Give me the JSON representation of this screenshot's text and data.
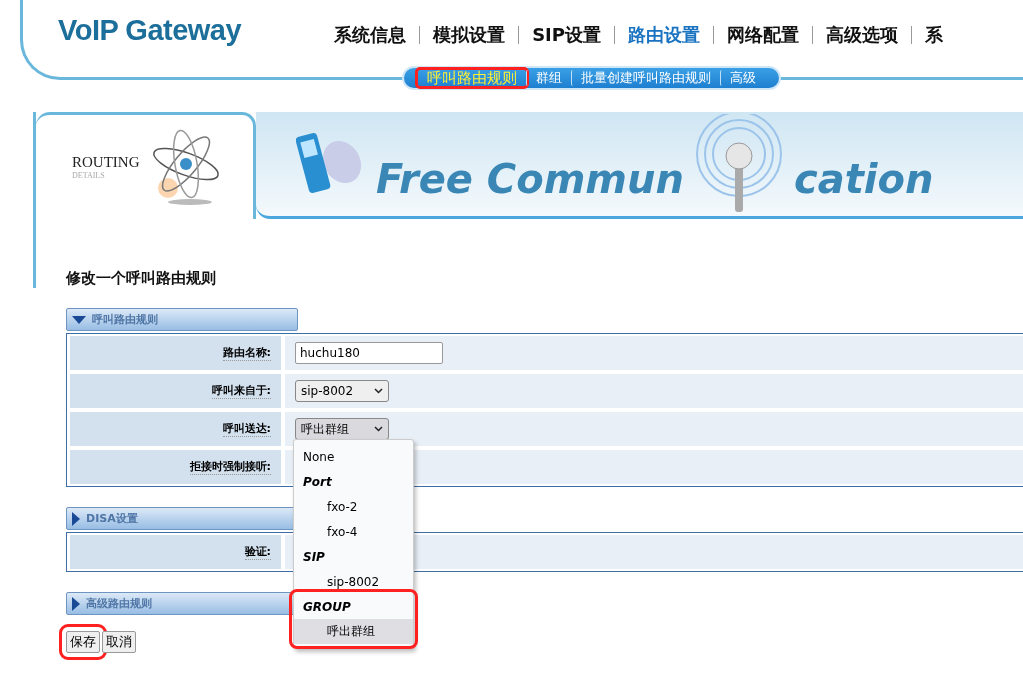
{
  "header": {
    "logo": "VoIP Gateway",
    "nav": [
      {
        "label": "系统信息",
        "selected": false
      },
      {
        "label": "模拟设置",
        "selected": false
      },
      {
        "label": "SIP设置",
        "selected": false
      },
      {
        "label": "路由设置",
        "selected": true
      },
      {
        "label": "网络配置",
        "selected": false
      },
      {
        "label": "高级选项",
        "selected": false
      },
      {
        "label": "系",
        "selected": false
      }
    ]
  },
  "subnav": [
    {
      "label": "呼叫路由规则",
      "selected": true,
      "highlighted": true
    },
    {
      "label": "群组",
      "selected": false,
      "highlighted": false
    },
    {
      "label": "批量创建呼叫路由规则",
      "selected": false,
      "highlighted": false
    },
    {
      "label": "高级",
      "selected": false,
      "highlighted": false
    }
  ],
  "banner": {
    "title": "ROUTING",
    "subtitle": "DETAILS",
    "slogan_start": "Free Commun",
    "slogan_end": "cation"
  },
  "page_title": "修改一个呼叫路由规则",
  "sections": [
    {
      "title": "呼叫路由规则",
      "expanded": true,
      "rows": [
        {
          "label": "路由名称:",
          "kind": "text",
          "value": "huchu180"
        },
        {
          "label": "呼叫来自于:",
          "kind": "select",
          "value": "sip-8002",
          "open": false
        },
        {
          "label": "呼叫送达:",
          "kind": "select",
          "value": "呼出群组",
          "open": true
        },
        {
          "label": "拒接时强制接听:",
          "kind": "blank"
        }
      ]
    },
    {
      "title": "DISA设置",
      "expanded": false,
      "rows": [
        {
          "label": "验证:",
          "kind": "blank"
        }
      ]
    },
    {
      "title": "高级路由规则",
      "expanded": false
    }
  ],
  "dropdown": {
    "items": [
      {
        "kind": "option",
        "label": "None",
        "selected": false
      },
      {
        "kind": "group",
        "label": "Port",
        "highlighted": false,
        "children": [
          {
            "label": "fxo-2",
            "selected": false
          },
          {
            "label": "fxo-4",
            "selected": false
          }
        ]
      },
      {
        "kind": "group",
        "label": "SIP",
        "highlighted": false,
        "children": [
          {
            "label": "sip-8002",
            "selected": false
          }
        ]
      },
      {
        "kind": "group",
        "label": "GROUP",
        "highlighted": true,
        "children": [
          {
            "label": "呼出群组",
            "selected": true
          }
        ]
      }
    ]
  },
  "buttons": [
    {
      "label": "保存",
      "highlighted": true
    },
    {
      "label": "取消",
      "highlighted": false
    }
  ]
}
